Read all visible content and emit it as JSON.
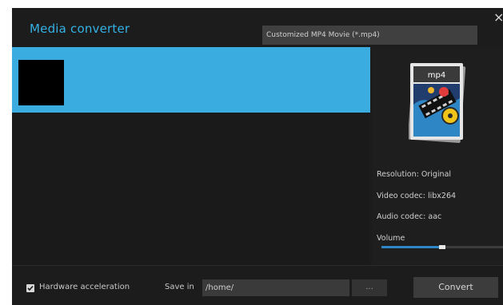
{
  "window": {
    "title": "Media converter",
    "close_glyph": "×"
  },
  "format_select": {
    "value": "Customized MP4 Movie (*.mp4)"
  },
  "format_icon": {
    "label": "mp4"
  },
  "info": {
    "resolution": "Resolution: Original",
    "video_codec": "Video codec: libx264",
    "audio_codec": "Audio codec: aac",
    "volume_label": "Volume"
  },
  "volume": {
    "level": 0.5
  },
  "bottom": {
    "hardware_acceleration": "Hardware acceleration",
    "hardware_acceleration_checked": true,
    "save_in_label": "Save in",
    "save_path": "/home/",
    "browse_label": "...",
    "convert_label": "Convert"
  },
  "colors": {
    "accent": "#34b1e4",
    "selection": "#3aace0",
    "background": "#1c1c1c"
  }
}
